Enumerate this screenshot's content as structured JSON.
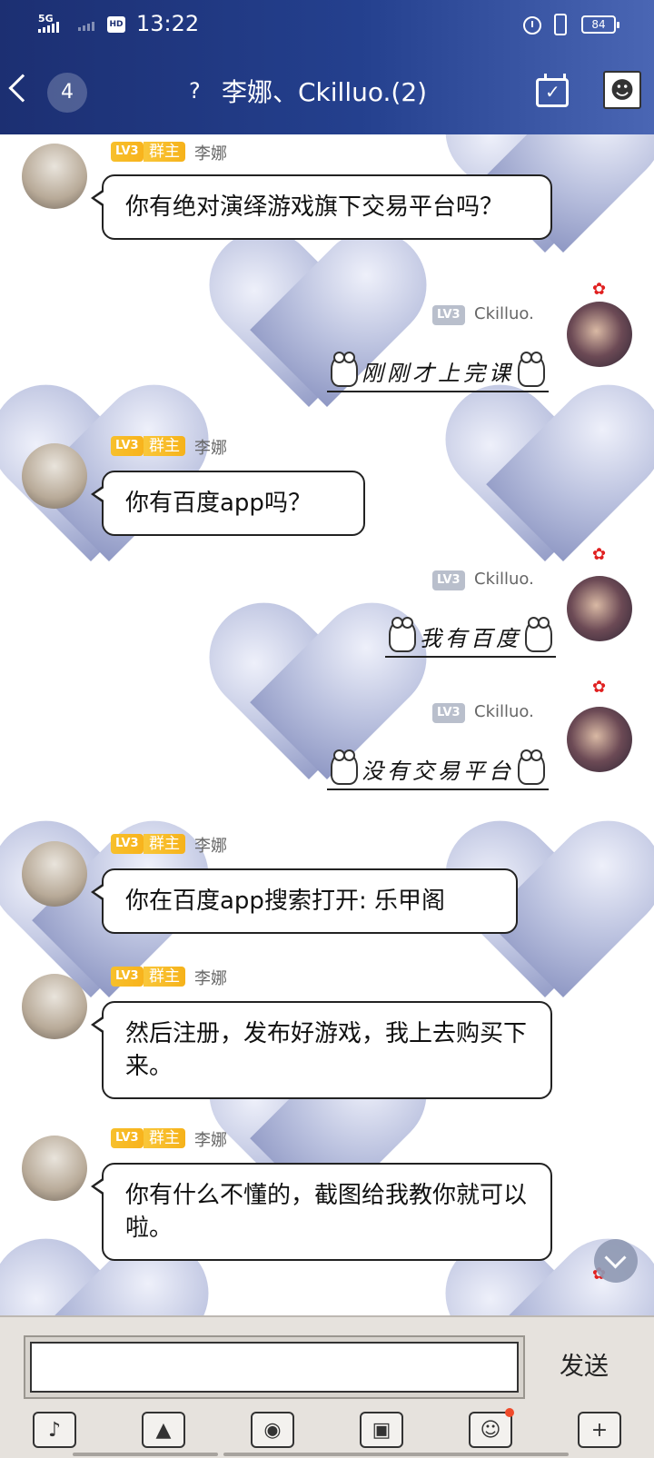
{
  "status_bar": {
    "network": "5G",
    "hd": "HD",
    "time": "13:22",
    "battery": "84"
  },
  "header": {
    "unread_count": "4",
    "title": "李娜、Ckilluo.(2)"
  },
  "messages": [
    {
      "sender": "李娜",
      "level": "LV3",
      "role": "群主",
      "text": "你有绝对演绎游戏旗下交易平台吗？"
    },
    {
      "sender": "Ckilluo.",
      "level": "LV3",
      "text": "刚刚才上完课"
    },
    {
      "sender": "李娜",
      "level": "LV3",
      "role": "群主",
      "text": "你有百度app吗？"
    },
    {
      "sender": "Ckilluo.",
      "level": "LV3",
      "text": "我有百度"
    },
    {
      "sender": "Ckilluo.",
      "level": "LV3",
      "text": "没有交易平台"
    },
    {
      "sender": "李娜",
      "level": "LV3",
      "role": "群主",
      "text": "你在百度app搜索打开: 乐甲阁"
    },
    {
      "sender": "李娜",
      "level": "LV3",
      "role": "群主",
      "text": "然后注册，发布好游戏，我上去购买下来。"
    },
    {
      "sender": "李娜",
      "level": "LV3",
      "role": "群主",
      "text": "你有什么不懂的，截图给我教你就可以啦。"
    }
  ],
  "composer": {
    "input_value": "",
    "send_label": "发送"
  },
  "toolbar_icons": [
    "voice-icon",
    "image-icon",
    "camera-icon",
    "red-packet-icon",
    "emoji-icon",
    "plus-icon"
  ],
  "colors": {
    "header_start": "#1c2f72",
    "header_end": "#4a66b4",
    "role_badge": "#f8b31c",
    "notification_dot": "#f04a2a"
  }
}
